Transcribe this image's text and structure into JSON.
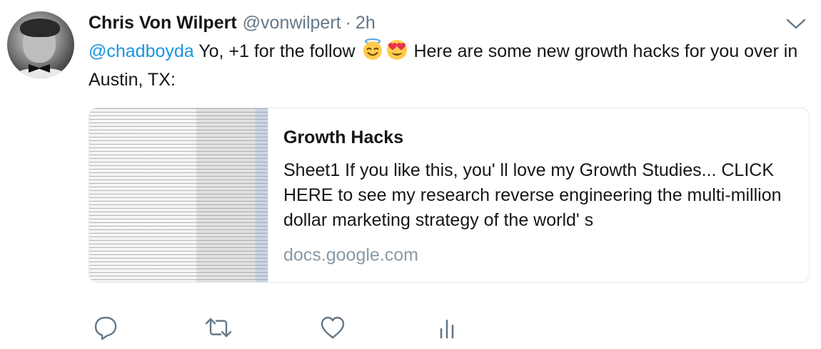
{
  "tweet": {
    "author_name": "Chris Von Wilpert",
    "author_handle": "@vonwilpert",
    "separator": "·",
    "time": "2h",
    "mention": "@chadboyda",
    "text_part1": " Yo, +1 for the follow ",
    "emojis": [
      "smiling-face-with-halo",
      "smiling-face-with-heart-eyes"
    ],
    "text_part2": " Here are some new growth hacks for you over in Austin, TX:"
  },
  "card": {
    "title": "Growth Hacks",
    "description": "Sheet1 If you like this, you' ll love my Growth Studies... CLICK HERE to see my research reverse engineering the multi-million dollar marketing strategy of the world' s",
    "domain": "docs.google.com"
  },
  "icons": {
    "caret": "chevron-down-icon",
    "reply": "reply-icon",
    "retweet": "retweet-icon",
    "like": "heart-icon",
    "analytics": "analytics-icon"
  },
  "colors": {
    "link": "#1b95e0",
    "secondary_text": "#657786",
    "icon": "#657786",
    "border": "#e1e8ed"
  }
}
